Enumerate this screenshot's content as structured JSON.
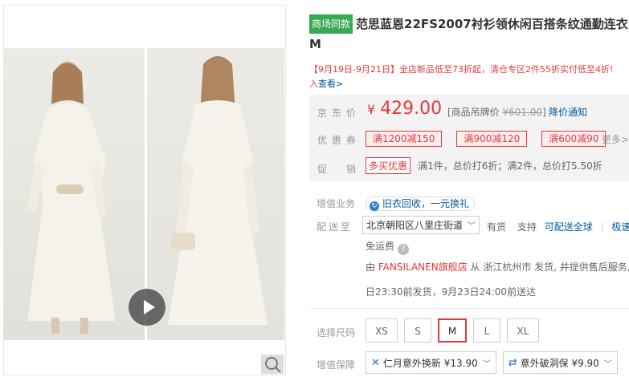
{
  "gallery": {
    "video_icon": "play-icon",
    "zoom_icon": "magnifier-icon"
  },
  "title": {
    "tag": "商场同款",
    "text": "范思蓝恩22FS2007衬衫领休闲百搭条纹通勤连衣",
    "line2": "M"
  },
  "promo": {
    "text": "【9月19日-9月21日】全店新品低至73折起，清仓专区2件55折实付低至4折!",
    "cont": "入",
    "link": "查看>"
  },
  "price": {
    "label": "京东价",
    "currency": "¥",
    "value": "429.00",
    "tag_price_label": "[商品吊牌价",
    "tag_price": "¥601.00",
    "tag_price_close": "]",
    "notify": "降价通知"
  },
  "coupons": {
    "label": "优惠券",
    "items": [
      "满1200减150",
      "满900减120",
      "满600减90"
    ],
    "more": "更多>"
  },
  "sales": {
    "label": "促　销",
    "tag": "多买优惠",
    "text": "满1件，总价打6折；满2件，总价打5.50折"
  },
  "value_add": {
    "label": "增值业务",
    "icon": "recycle-icon",
    "text": "旧衣回收，一元换礼"
  },
  "delivery": {
    "label": "配送至",
    "address": "北京朝阳区八里庄街道",
    "stock": "有货",
    "support": "支持",
    "support_link": "可配送全球",
    "fast": "极速",
    "fee": "免运费",
    "shop_prefix": "由",
    "shop": "FANSILANEN旗舰店",
    "shop_suffix": "从 浙江杭州市 发货, 并提供售后服务,",
    "eta": "日23:30前发货，9月23日24:00前送达"
  },
  "sizes": {
    "label": "选择尺码",
    "options": [
      "XS",
      "S",
      "M",
      "L",
      "XL"
    ],
    "selected": "M"
  },
  "protect": {
    "label": "增值保障",
    "items": [
      {
        "icon": "tools-icon",
        "text": "仁月意外换新 ¥13.90"
      },
      {
        "icon": "shield-icon",
        "text": "意外破洞保 ¥9.90"
      }
    ]
  }
}
